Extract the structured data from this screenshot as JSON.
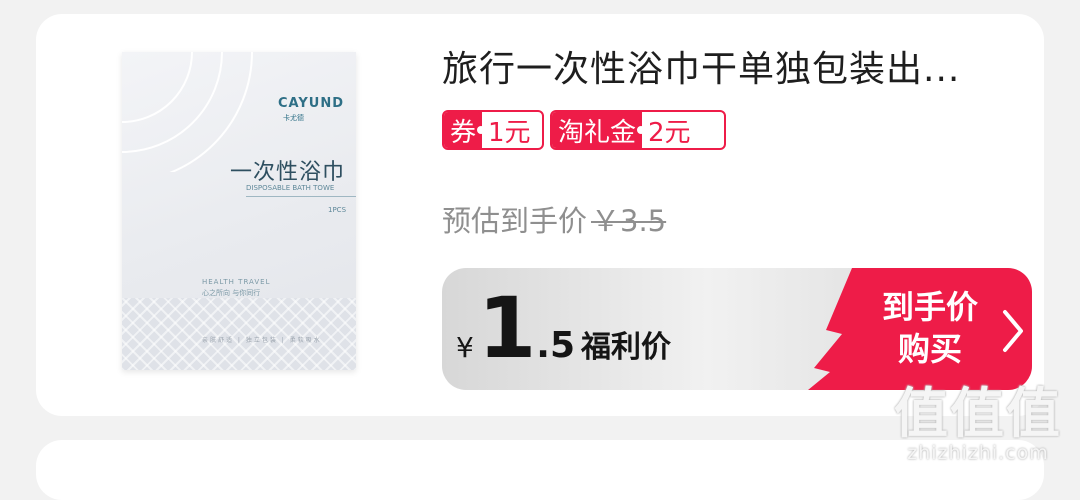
{
  "product": {
    "title": "旅行一次性浴巾干单独包装出...",
    "image": {
      "brand": "CAYUND",
      "brand_sub": "卡尤德",
      "name": "一次性浴巾",
      "name_en": "DISPOSABLE BATH TOWE",
      "pcs": "1PCS",
      "health": "HEALTH TRAVEL",
      "health_sub": "心之所向 与你同行",
      "quilt_text": "亲肤舒适   |   独立包装   |   柔软吸水"
    }
  },
  "tags": [
    {
      "left": "券",
      "right": "1元"
    },
    {
      "left": "淘礼金",
      "right": "2元"
    }
  ],
  "estimate": {
    "label": "预估到手价",
    "old_price": "￥3.5"
  },
  "buy": {
    "yen": "¥",
    "price_int": "1",
    "price_dec": ".5",
    "price_label": "福利价",
    "cta_line1": "到手价",
    "cta_line2": "购买"
  },
  "watermark": {
    "big": "值值值",
    "site": "zhizhizhi.com"
  },
  "colors": {
    "accent": "#ee1c48",
    "cta": "#ee1c48",
    "text": "#1e1e1e",
    "muted": "#8f8f8f"
  }
}
